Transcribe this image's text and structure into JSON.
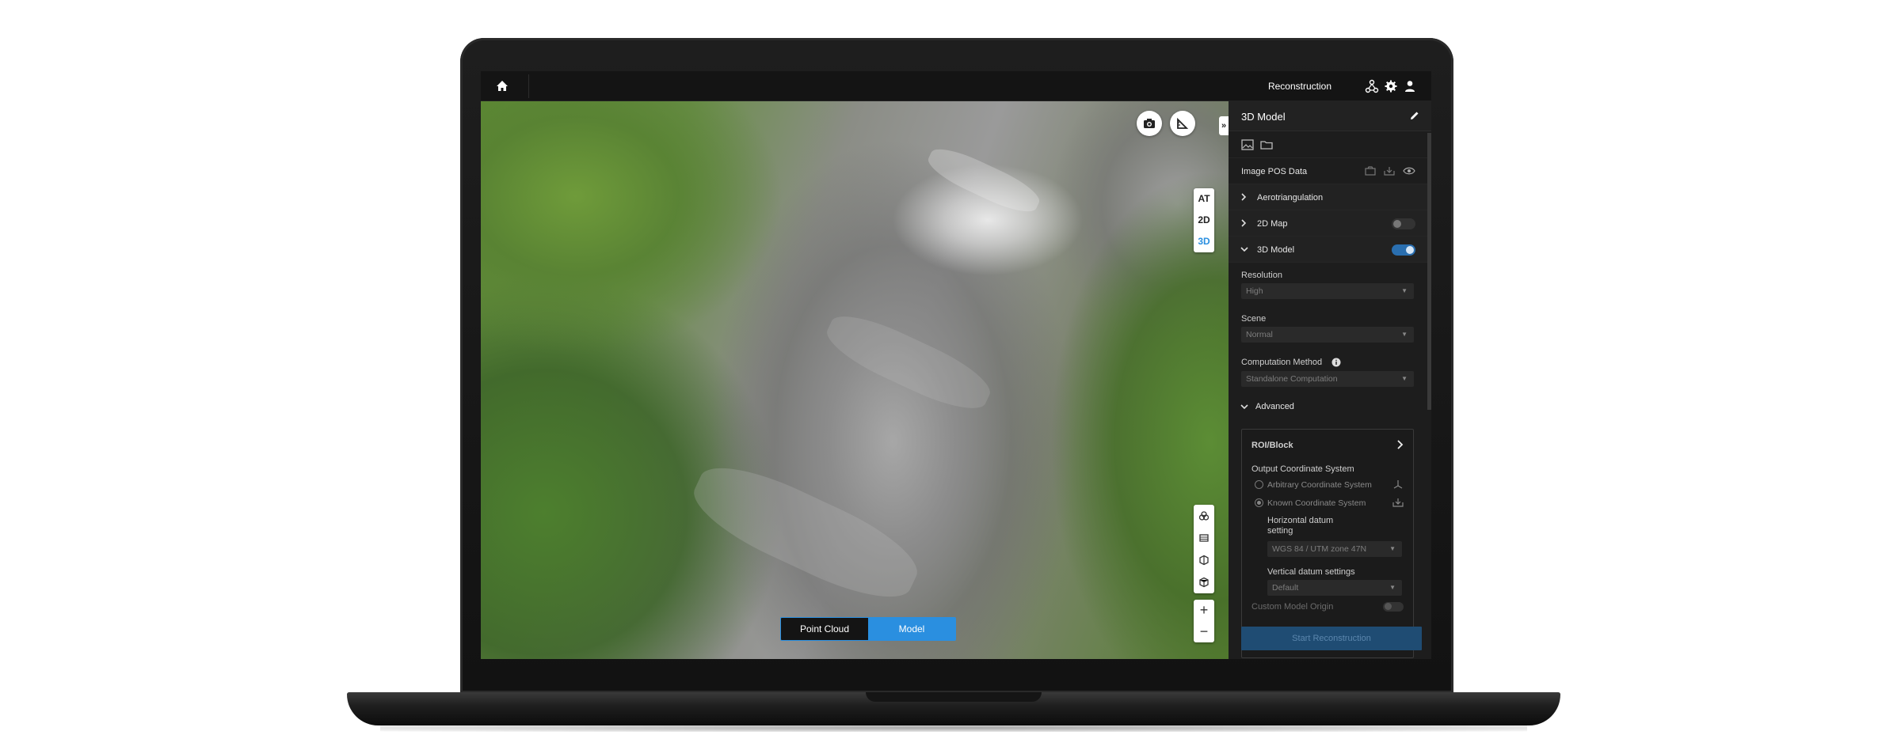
{
  "topbar": {
    "title": "Reconstruction",
    "icons": [
      "home-icon",
      "network-icon",
      "gear-icon",
      "user-icon"
    ]
  },
  "viewport": {
    "modes": [
      "AT",
      "2D",
      "3D"
    ],
    "active_mode": "3D",
    "collapse_glyph": "»",
    "zoom_in": "+",
    "zoom_out": "−",
    "view_toggle": {
      "point_cloud": "Point Cloud",
      "model": "Model",
      "active": "Model"
    }
  },
  "panel": {
    "title": "3D Model",
    "image_pos_data": "Image POS Data",
    "sections": {
      "aerotriangulation": "Aerotriangulation",
      "map2d": "2D Map",
      "model3d": "3D Model"
    },
    "map2d_enabled": false,
    "model3d_enabled": true,
    "resolution_label": "Resolution",
    "resolution_value": "High",
    "scene_label": "Scene",
    "scene_value": "Normal",
    "computation_label": "Computation Method",
    "computation_value": "Standalone Computation",
    "advanced_label": "Advanced",
    "roi_label": "ROI/Block",
    "output_coord_label": "Output Coordinate System",
    "arbitrary_coord": "Arbitrary Coordinate System",
    "known_coord": "Known Coordinate System",
    "horizontal_datum_label": "Horizontal datum setting",
    "horizontal_datum_value": "WGS 84 / UTM zone 47N",
    "vertical_datum_label": "Vertical datum settings",
    "vertical_datum_value": "Default",
    "custom_origin_label": "Custom Model Origin",
    "start_button": "Start Reconstruction"
  },
  "colors": {
    "accent": "#2a8fe0",
    "panel_bg": "#1d1d1d",
    "topbar_bg": "#141414"
  }
}
